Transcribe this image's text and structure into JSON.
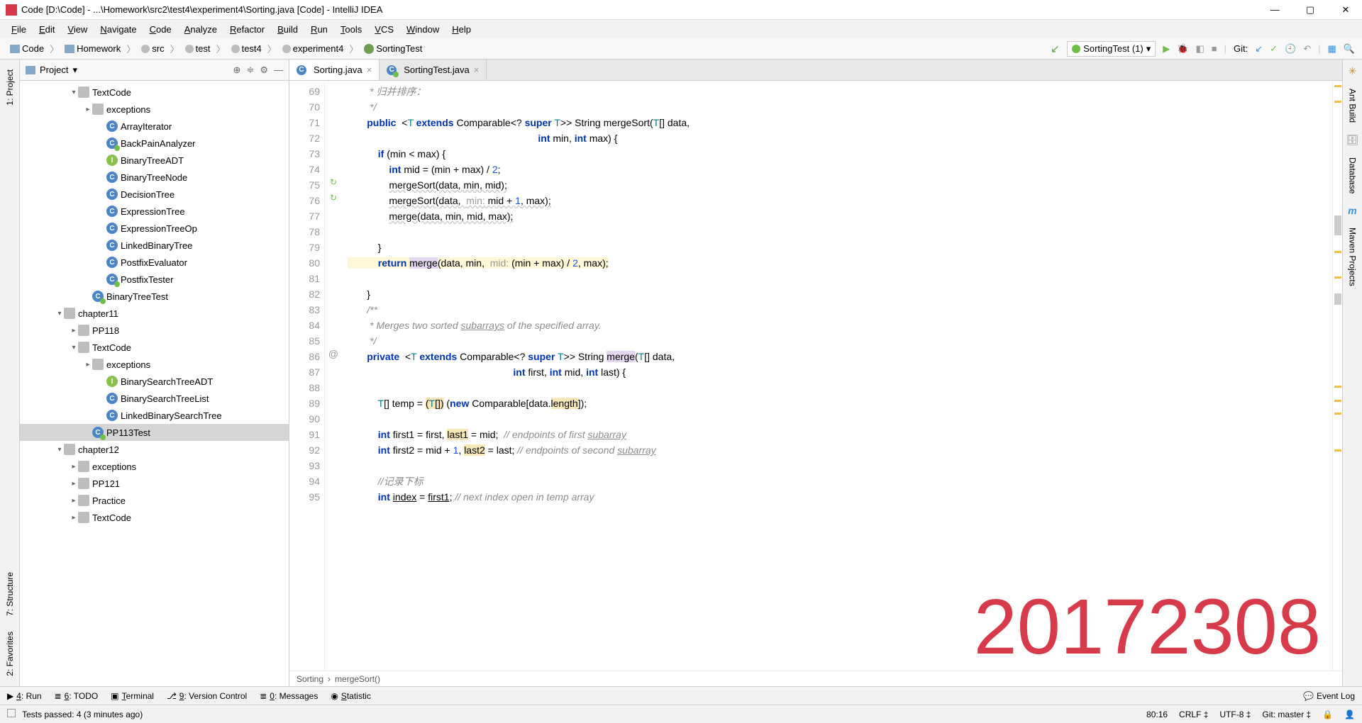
{
  "titlebar": {
    "title": "Code [D:\\Code] - ...\\Homework\\src2\\test4\\experiment4\\Sorting.java [Code] - IntelliJ IDEA"
  },
  "menubar": [
    "File",
    "Edit",
    "View",
    "Navigate",
    "Code",
    "Analyze",
    "Refactor",
    "Build",
    "Run",
    "Tools",
    "VCS",
    "Window",
    "Help"
  ],
  "breadcrumb": [
    "Code",
    "Homework",
    "src",
    "test",
    "test4",
    "experiment4",
    "SortingTest"
  ],
  "run_config": "SortingTest (1)",
  "git_label": "Git:",
  "project": {
    "title": "Project",
    "tree": [
      {
        "depth": 3,
        "icon": "folder",
        "label": "TextCode",
        "arrow": "▾"
      },
      {
        "depth": 4,
        "icon": "folder",
        "label": "exceptions",
        "arrow": "▸"
      },
      {
        "depth": 5,
        "icon": "cls",
        "label": "ArrayIterator",
        "arrow": ""
      },
      {
        "depth": 5,
        "icon": "test",
        "label": "BackPainAnalyzer",
        "arrow": ""
      },
      {
        "depth": 5,
        "icon": "iface",
        "label": "BinaryTreeADT",
        "arrow": ""
      },
      {
        "depth": 5,
        "icon": "cls",
        "label": "BinaryTreeNode",
        "arrow": ""
      },
      {
        "depth": 5,
        "icon": "cls",
        "label": "DecisionTree",
        "arrow": ""
      },
      {
        "depth": 5,
        "icon": "cls",
        "label": "ExpressionTree",
        "arrow": ""
      },
      {
        "depth": 5,
        "icon": "cls",
        "label": "ExpressionTreeOp",
        "arrow": ""
      },
      {
        "depth": 5,
        "icon": "cls",
        "label": "LinkedBinaryTree",
        "arrow": ""
      },
      {
        "depth": 5,
        "icon": "cls",
        "label": "PostfixEvaluator",
        "arrow": ""
      },
      {
        "depth": 5,
        "icon": "test",
        "label": "PostfixTester",
        "arrow": ""
      },
      {
        "depth": 4,
        "icon": "test",
        "label": "BinaryTreeTest",
        "arrow": ""
      },
      {
        "depth": 2,
        "icon": "folder",
        "label": "chapter11",
        "arrow": "▾"
      },
      {
        "depth": 3,
        "icon": "folder",
        "label": "PP118",
        "arrow": "▸"
      },
      {
        "depth": 3,
        "icon": "folder",
        "label": "TextCode",
        "arrow": "▾"
      },
      {
        "depth": 4,
        "icon": "folder",
        "label": "exceptions",
        "arrow": "▸"
      },
      {
        "depth": 5,
        "icon": "iface",
        "label": "BinarySearchTreeADT",
        "arrow": ""
      },
      {
        "depth": 5,
        "icon": "cls",
        "label": "BinarySearchTreeList",
        "arrow": ""
      },
      {
        "depth": 5,
        "icon": "cls",
        "label": "LinkedBinarySearchTree",
        "arrow": ""
      },
      {
        "depth": 4,
        "icon": "test",
        "label": "PP113Test",
        "arrow": "",
        "selected": true
      },
      {
        "depth": 2,
        "icon": "folder",
        "label": "chapter12",
        "arrow": "▾"
      },
      {
        "depth": 3,
        "icon": "folder",
        "label": "exceptions",
        "arrow": "▸"
      },
      {
        "depth": 3,
        "icon": "folder",
        "label": "PP121",
        "arrow": "▸"
      },
      {
        "depth": 3,
        "icon": "folder",
        "label": "Practice",
        "arrow": "▸"
      },
      {
        "depth": 3,
        "icon": "folder",
        "label": "TextCode",
        "arrow": "▸"
      }
    ]
  },
  "tabs": [
    {
      "label": "Sorting.java",
      "active": true
    },
    {
      "label": "SortingTest.java",
      "active": false
    }
  ],
  "gutter_lines": [
    "69",
    "70",
    "71",
    "72",
    "73",
    "74",
    "75",
    "76",
    "77",
    "78",
    "79",
    "80",
    "81",
    "82",
    "83",
    "84",
    "85",
    "86",
    "87",
    "88",
    "89",
    "90",
    "91",
    "92",
    "93",
    "94",
    "95"
  ],
  "gutter_icons": {
    "75": "recursion",
    "76": "recursion",
    "86": "override"
  },
  "code_breadcrumb": [
    "Sorting",
    "mergeSort()"
  ],
  "right_panels": [
    "Ant Build",
    "Database",
    "Maven Projects"
  ],
  "left_panels_top": [
    "1: Project"
  ],
  "left_panels_bottom": [
    "7: Structure",
    "2: Favorites"
  ],
  "bottom_tools": [
    {
      "icon": "▶",
      "label": "4: Run"
    },
    {
      "icon": "≣",
      "label": "6: TODO"
    },
    {
      "icon": "▣",
      "label": "Terminal"
    },
    {
      "icon": "⎇",
      "label": "9: Version Control"
    },
    {
      "icon": "≣",
      "label": "0: Messages"
    },
    {
      "icon": "◉",
      "label": "Statistic"
    }
  ],
  "event_log": "Event Log",
  "status": {
    "left": "Tests passed: 4 (3 minutes ago)",
    "pos": "80:16",
    "eol": "CRLF ‡",
    "enc": "UTF-8 ‡",
    "git": "Git: master ‡",
    "lock": "🔒"
  },
  "watermark": "20172308"
}
